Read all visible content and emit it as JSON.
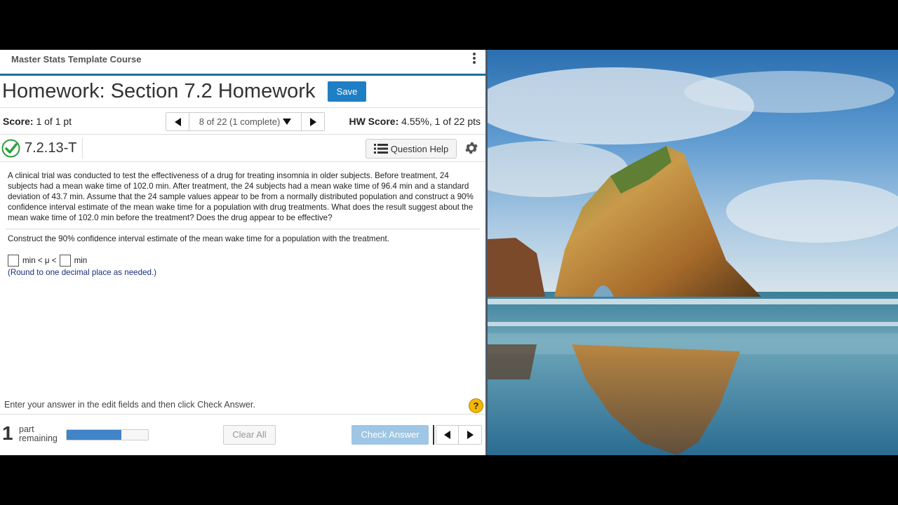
{
  "course": {
    "title": "Master Stats Template Course"
  },
  "homework": {
    "title": "Homework: Section 7.2 Homework",
    "save_label": "Save"
  },
  "score": {
    "label": "Score:",
    "value": "1 of 1 pt",
    "question_selector": "8 of 22 (1 complete)",
    "hw_label": "HW Score:",
    "hw_value": "4.55%, 1 of 22 pts"
  },
  "question": {
    "id": "7.2.13-T",
    "help_label": "Question Help",
    "status": "correct"
  },
  "problem": {
    "text": "A clinical trial was conducted to test the effectiveness of a drug for treating insomnia in older subjects. Before treatment, 24 subjects had a mean wake time of 102.0 min. After treatment, the 24 subjects had a mean wake time of 96.4 min and a standard deviation of 43.7 min. Assume that the 24 sample values appear to be from a normally distributed population and construct a 90% confidence interval estimate of the mean wake time for a population with drug treatments. What does the result suggest about the mean wake time of 102.0 min before the treatment? Does the drug appear to be effective?",
    "instruction": "Construct the 90% confidence interval estimate of the mean wake time for a population with the treatment.",
    "answer_mid": "min < μ <",
    "answer_end": "min",
    "note": "(Round to one decimal place as needed.)"
  },
  "footer": {
    "hint": "Enter your answer in the edit fields and then click Check Answer.",
    "help_symbol": "?",
    "parts_count": "1",
    "parts_word": "part",
    "remaining_word": "remaining",
    "progress_fraction": 0.67,
    "clear_label": "Clear All",
    "check_label": "Check Answer"
  },
  "colors": {
    "accent": "#1f7fc4",
    "header_rule": "#1e6f9f",
    "check_green": "#2e9e3e",
    "note_blue": "#1a2e7a",
    "help_yellow": "#f2b800"
  },
  "icons": [
    "kebab-menu-icon",
    "triangle-left-icon",
    "triangle-down-icon",
    "triangle-right-icon",
    "checkmark-circle-icon",
    "list-icon",
    "gear-icon",
    "question-mark-icon"
  ]
}
